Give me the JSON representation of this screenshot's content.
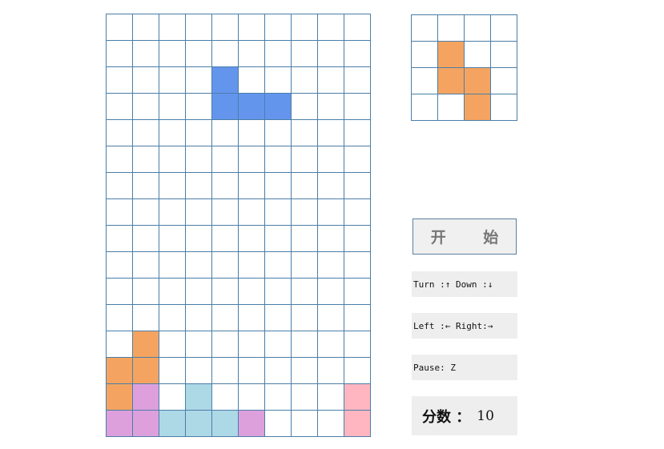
{
  "colors": {
    "grid_line": "#4a7ea8",
    "empty": "#ffffff",
    "B": "#6495ed",
    "O": "#f4a460",
    "P": "#dda0dd",
    "L": "#add8e6",
    "K": "#ffb6c1"
  },
  "board": {
    "cols": 10,
    "rows": 16,
    "cells": [
      "..........",
      "..........",
      "....B.....",
      "....BBB...",
      "..........",
      "..........",
      "..........",
      "..........",
      "..........",
      "..........",
      "..........",
      "..........",
      ".O........",
      "OO........",
      "OP.L.....K",
      "PPLLLP...K"
    ]
  },
  "preview": {
    "cols": 4,
    "rows": 4,
    "cells": [
      "....",
      ".O..",
      ".OO.",
      "..O."
    ]
  },
  "controls": {
    "start_label": "开 始",
    "turn_down_text": "Turn :↑ Down :↓",
    "left_right_text": "Left :← Right:→",
    "pause_text": "Pause: Z"
  },
  "score": {
    "label": "分数 ：",
    "value": "10"
  }
}
